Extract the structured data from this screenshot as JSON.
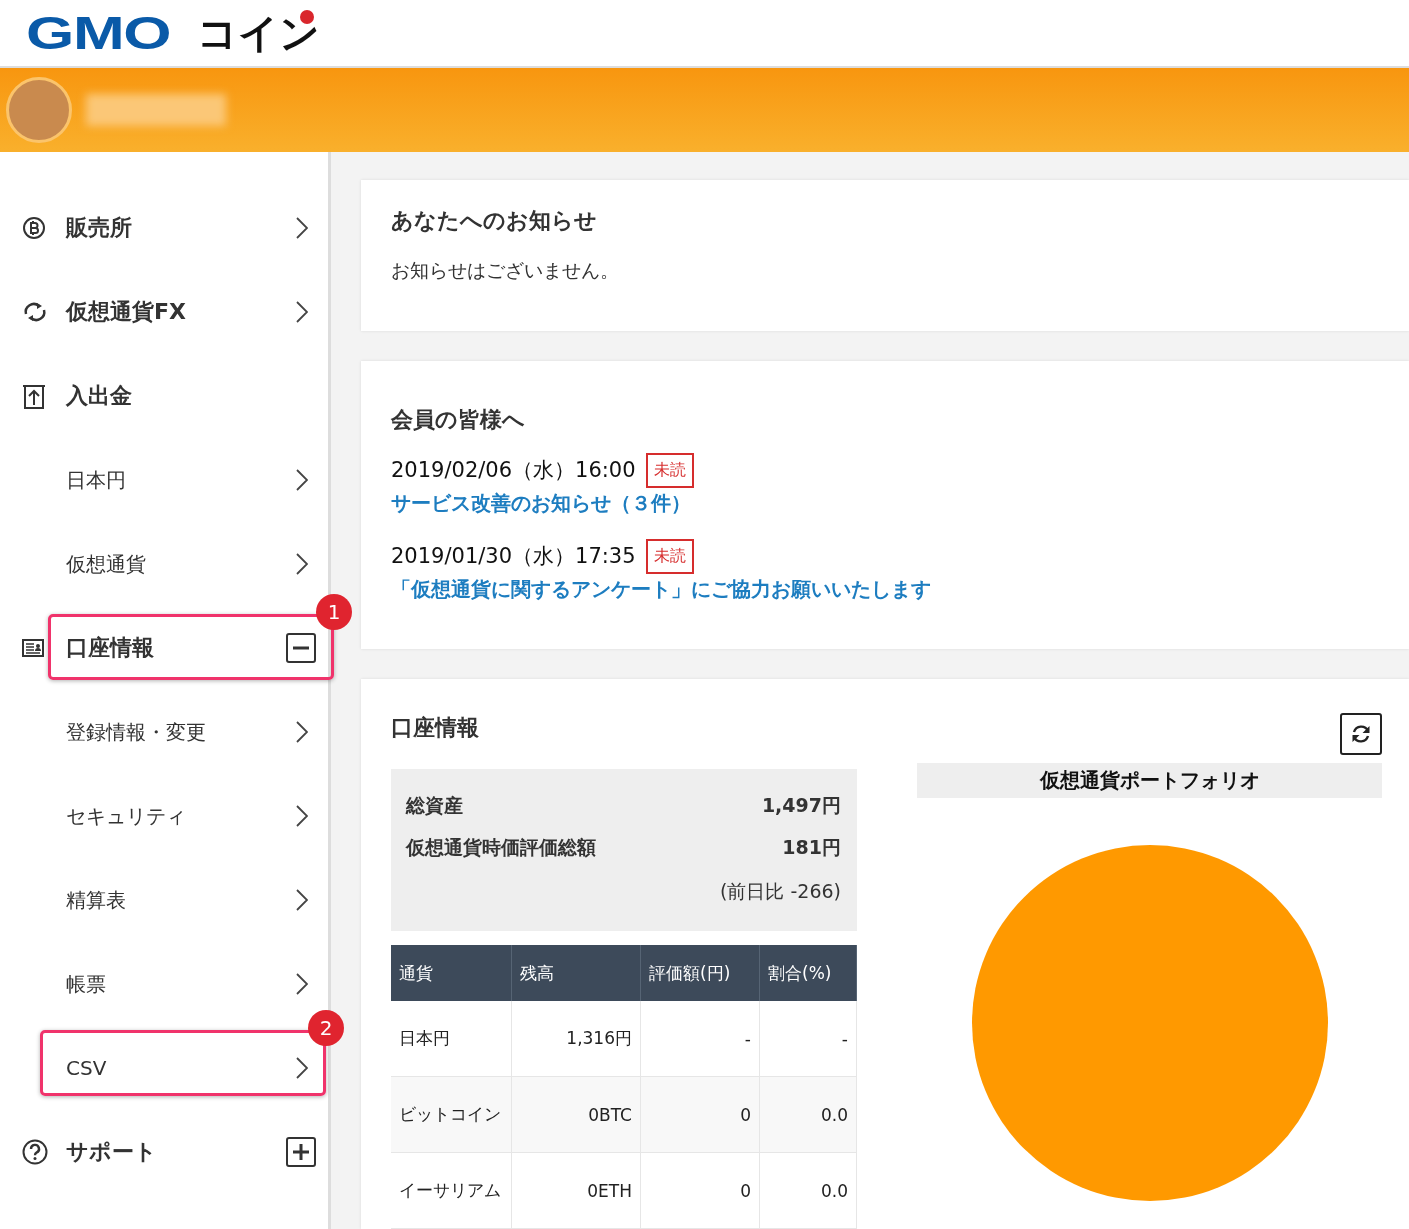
{
  "header": {
    "logo": {
      "latin": "GMO",
      "kana": "コイン"
    }
  },
  "sidebar": {
    "items": [
      {
        "kind": "menu",
        "label": "販売所"
      },
      {
        "kind": "menu",
        "label": "仮想通貨FX"
      },
      {
        "kind": "heading",
        "label": "入出金"
      },
      {
        "kind": "sub",
        "label": "日本円"
      },
      {
        "kind": "sub",
        "label": "仮想通貨"
      },
      {
        "kind": "folder",
        "label": "口座情報",
        "expanded": true,
        "callout": "1"
      },
      {
        "kind": "sub",
        "label": "登録情報・変更"
      },
      {
        "kind": "sub",
        "label": "セキュリティ"
      },
      {
        "kind": "sub",
        "label": "精算表"
      },
      {
        "kind": "sub",
        "label": "帳票"
      },
      {
        "kind": "sub",
        "label": "CSV",
        "callout": "2"
      },
      {
        "kind": "folder",
        "label": "サポート",
        "expanded": false
      }
    ]
  },
  "notice_card": {
    "title": "あなたへのお知らせ",
    "message": "お知らせはございません。"
  },
  "member_card": {
    "title": "会員の皆様へ",
    "notices": [
      {
        "datetime": "2019/02/06（水）16:00",
        "badge": "未読",
        "link": "サービス改善のお知らせ（３件）"
      },
      {
        "datetime": "2019/01/30（水）17:35",
        "badge": "未読",
        "link": "「仮想通貨に関するアンケート」にご協力お願いいたします"
      }
    ]
  },
  "account_card": {
    "title": "口座情報",
    "summary": [
      {
        "label": "総資産",
        "value": "1,497円"
      },
      {
        "label": "仮想通貨時価評価総額",
        "value": "181円"
      }
    ],
    "change": "(前日比 -266)",
    "table": {
      "columns": [
        "通貨",
        "残高",
        "評価額(円)",
        "割合(%)"
      ],
      "rows": [
        [
          "日本円",
          "1,316円",
          "-",
          "-"
        ],
        [
          "ビットコイン",
          "0BTC",
          "0",
          "0.0"
        ],
        [
          "イーサリアム",
          "0ETH",
          "0",
          "0.0"
        ]
      ]
    },
    "portfolio": {
      "title": "仮想通貨ポートフォリオ"
    }
  }
}
